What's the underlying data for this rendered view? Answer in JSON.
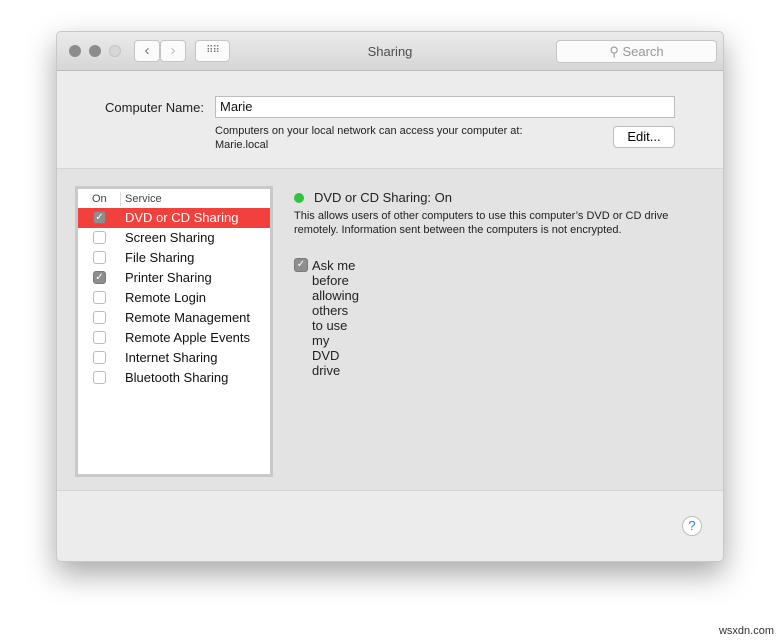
{
  "window": {
    "title": "Sharing",
    "search_placeholder": "Search",
    "back_icon": "chevron-left",
    "forward_icon": "chevron-right",
    "grid_icon": "grid-icon"
  },
  "top": {
    "computer_name_label": "Computer Name:",
    "computer_name_value": "Marie",
    "info_line1": "Computers on your local network can access your computer at:",
    "info_line2": "Marie.local",
    "edit_label": "Edit..."
  },
  "list": {
    "col_on": "On",
    "col_service": "Service",
    "items": [
      {
        "label": "DVD or CD Sharing",
        "checked": true,
        "selected": true
      },
      {
        "label": "Screen Sharing",
        "checked": false
      },
      {
        "label": "File Sharing",
        "checked": false
      },
      {
        "label": "Printer Sharing",
        "checked": true
      },
      {
        "label": "Remote Login",
        "checked": false
      },
      {
        "label": "Remote Management",
        "checked": false
      },
      {
        "label": "Remote Apple Events",
        "checked": false
      },
      {
        "label": "Internet Sharing",
        "checked": false
      },
      {
        "label": "Bluetooth Sharing",
        "checked": false
      }
    ]
  },
  "detail": {
    "status": "DVD or CD Sharing: On",
    "status_color": "#2ec43f",
    "description_line1": "This allows users of other computers to use this computer’s DVD or CD drive",
    "description_line2": "remotely. Information sent between the computers is not encrypted.",
    "ask_label": "Ask me before allowing others to use my DVD drive",
    "ask_checked": true
  },
  "help_label": "?",
  "watermark": "wsxdn.com"
}
